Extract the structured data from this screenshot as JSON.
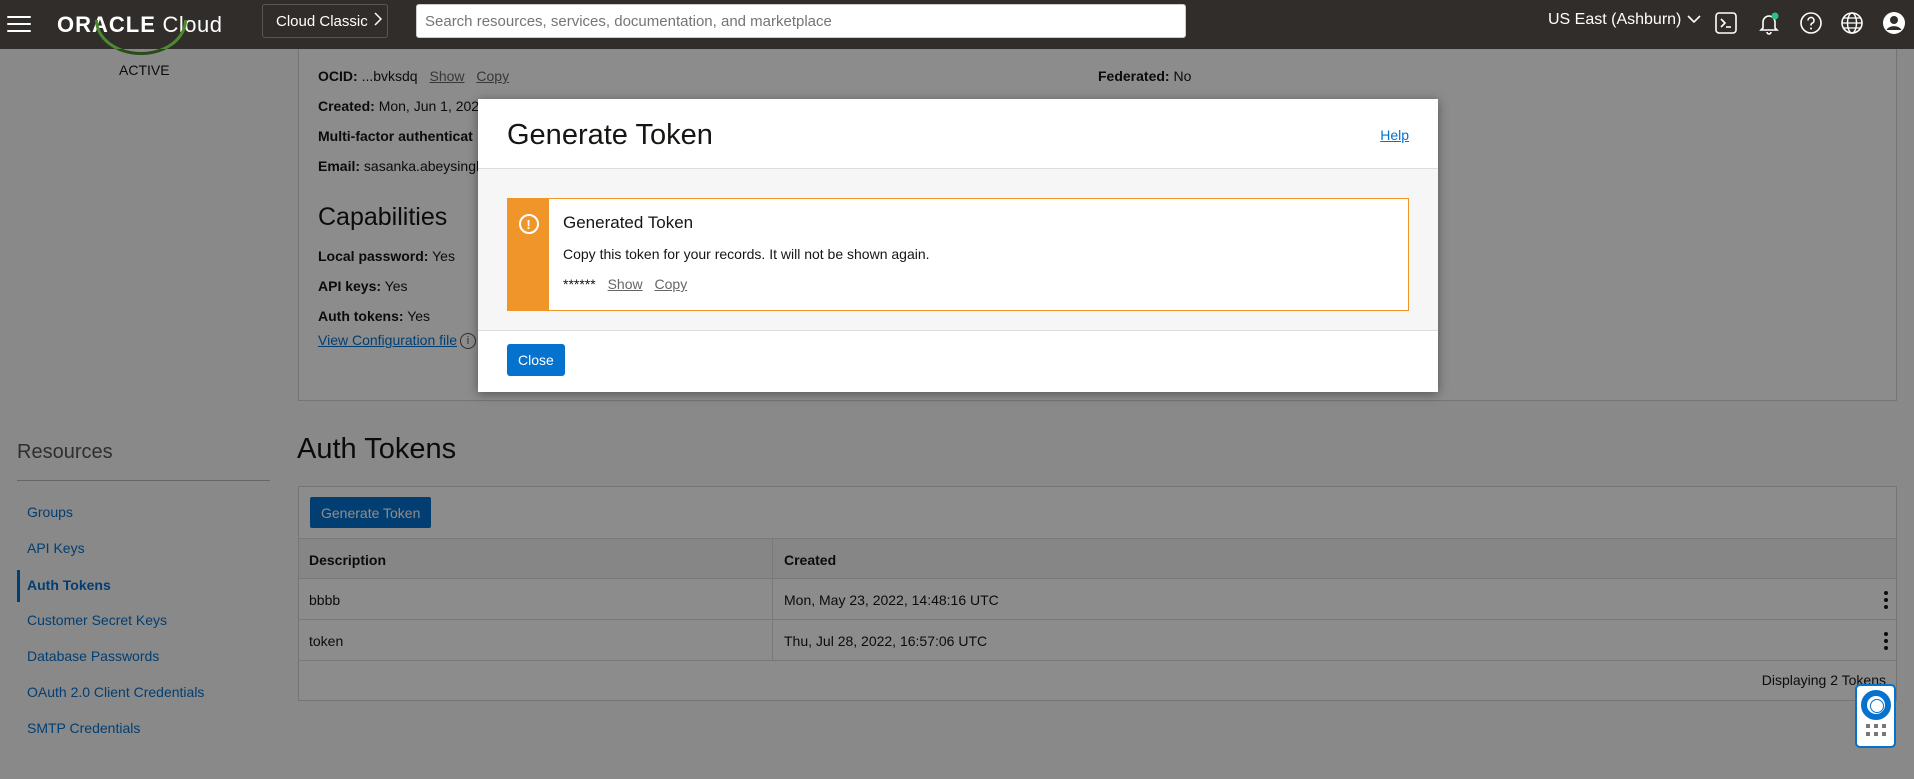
{
  "header": {
    "logo_brand": "ORACLE",
    "logo_product": "Cloud",
    "classic_label": "Cloud Classic",
    "search_placeholder": "Search resources, services, documentation, and marketplace",
    "region_label": "US East (Ashburn)",
    "icons": [
      "cloud-shell-icon",
      "bell-icon",
      "help-icon",
      "globe-icon",
      "user-icon"
    ]
  },
  "user": {
    "status": "ACTIVE",
    "ocid_label": "OCID:",
    "ocid_value": "...bvksdq",
    "show": "Show",
    "copy": "Copy",
    "federated_label": "Federated:",
    "federated_value": "No",
    "created_label": "Created:",
    "created_value": "Mon, Jun 1, 202",
    "mfa_label": "Multi-factor authenticat",
    "email_label": "Email:",
    "email_value": "sasanka.abeysingh"
  },
  "capabilities": {
    "title": "Capabilities",
    "local_password_label": "Local password:",
    "local_password_value": "Yes",
    "api_keys_label": "API keys:",
    "api_keys_value": "Yes",
    "auth_tokens_label": "Auth tokens:",
    "auth_tokens_value": "Yes",
    "view_config": "View Configuration file"
  },
  "resources": {
    "title": "Resources",
    "items": [
      "Groups",
      "API Keys",
      "Auth Tokens",
      "Customer Secret Keys",
      "Database Passwords",
      "OAuth 2.0 Client Credentials",
      "SMTP Credentials"
    ],
    "active_index": 2
  },
  "auth_tokens": {
    "title": "Auth Tokens",
    "generate_button": "Generate Token",
    "columns": [
      "Description",
      "Created"
    ],
    "rows": [
      {
        "description": "bbbb",
        "created": "Mon, May 23, 2022, 14:48:16 UTC"
      },
      {
        "description": "token",
        "created": "Thu, Jul 28, 2022, 16:57:06 UTC"
      }
    ],
    "footer": "Displaying 2 Tokens"
  },
  "modal": {
    "title": "Generate Token",
    "help": "Help",
    "alert_title": "Generated Token",
    "alert_message": "Copy this token for your records. It will not be shown again.",
    "token_masked": "******",
    "show": "Show",
    "copy": "Copy",
    "close_button": "Close"
  },
  "colors": {
    "header_bg": "#312d2a",
    "accent": "#0572ce",
    "warning": "#f0952a"
  }
}
